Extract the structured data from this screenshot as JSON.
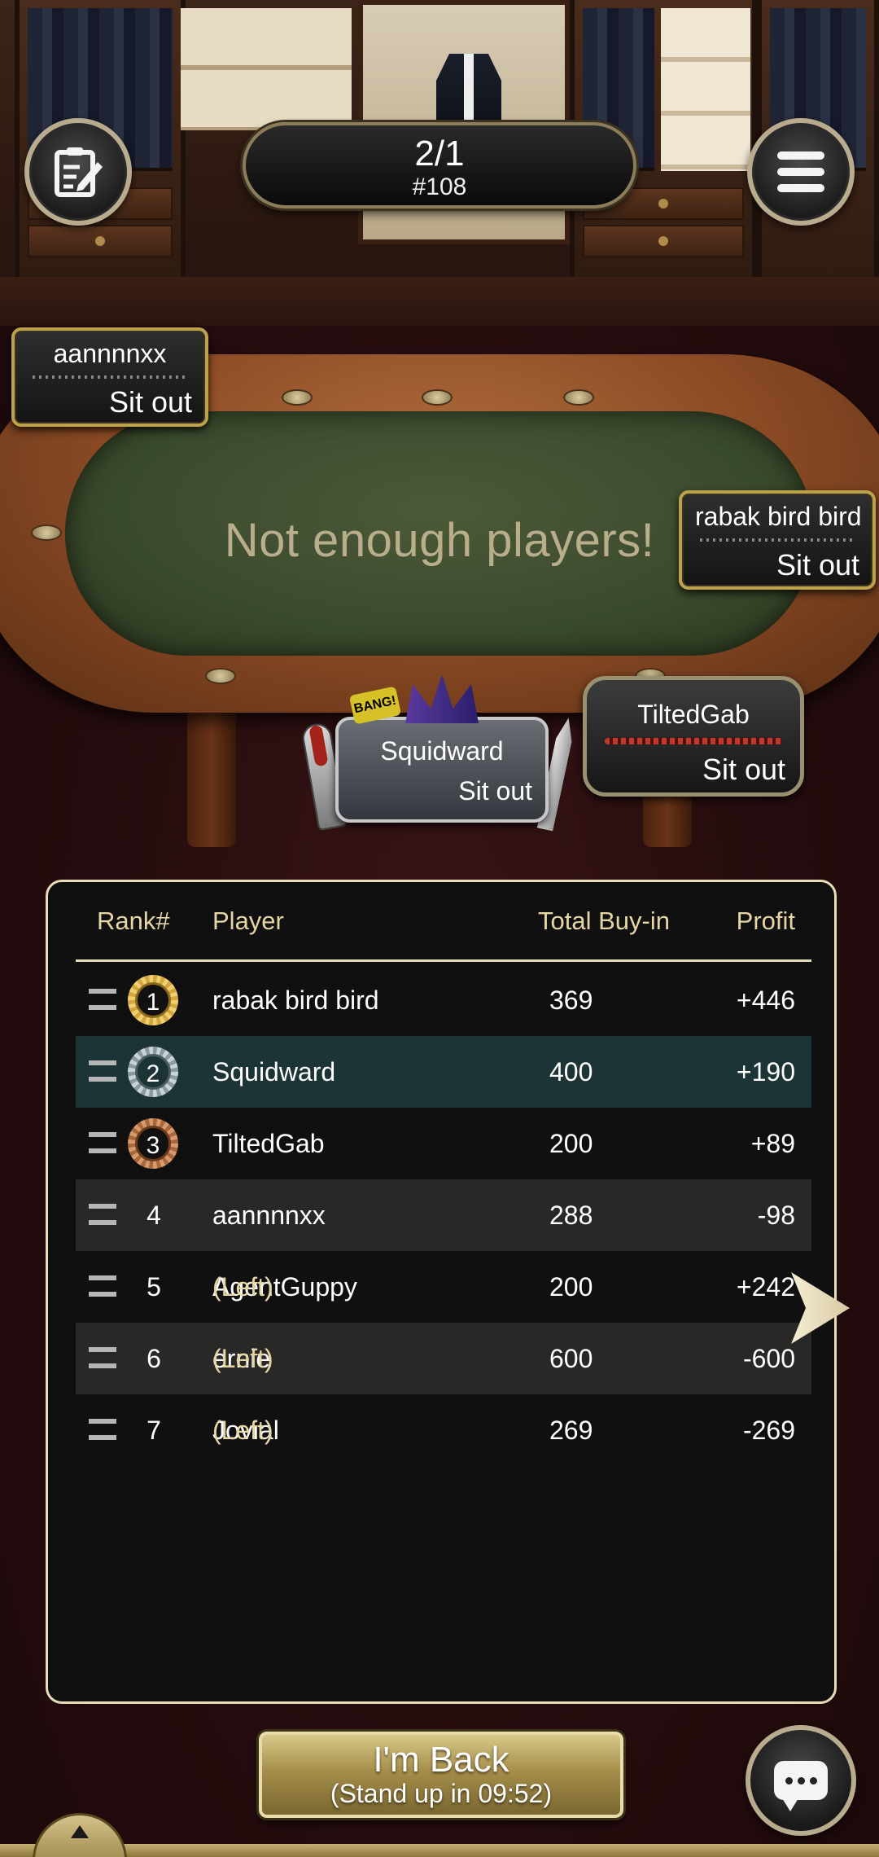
{
  "header": {
    "blinds": "2/1",
    "hand_number": "#108"
  },
  "table": {
    "message": "Not enough players!"
  },
  "seats": [
    {
      "name": "aannnnxx",
      "status": "Sit out"
    },
    {
      "name": "rabak bird bird",
      "status": "Sit out"
    },
    {
      "name": "TiltedGab",
      "status": "Sit out"
    },
    {
      "name": "Squidward",
      "status": "Sit out"
    }
  ],
  "squidward_sticker": "BANG!",
  "leaderboard": {
    "columns": {
      "rank": "Rank#",
      "player": "Player",
      "buyin": "Total Buy-in",
      "profit": "Profit"
    },
    "left_tag": "(Left)",
    "rows": [
      {
        "rank": "1",
        "player": "rabak bird bird",
        "buyin": "369",
        "profit": "+446"
      },
      {
        "rank": "2",
        "player": "Squidward",
        "buyin": "400",
        "profit": "+190"
      },
      {
        "rank": "3",
        "player": "TiltedGab",
        "buyin": "200",
        "profit": "+89"
      },
      {
        "rank": "4",
        "player": "aannnnxx",
        "buyin": "288",
        "profit": "-98"
      },
      {
        "rank": "5",
        "player": "AgentGuppy",
        "buyin": "200",
        "profit": "+242"
      },
      {
        "rank": "6",
        "player": "ernie",
        "buyin": "600",
        "profit": "-600"
      },
      {
        "rank": "7",
        "player": "Jovial",
        "buyin": "269",
        "profit": "-269"
      }
    ]
  },
  "actions": {
    "back_label": "I'm Back",
    "standup_label": "(Stand up in 09:52)"
  },
  "icons": {
    "notes": "notes-icon",
    "menu": "hamburger-icon",
    "chat": "chat-bubble-icon",
    "next": "arrow-right-icon",
    "drawer": "arrow-up-icon"
  },
  "colors": {
    "gold_text": "#e6d6a4",
    "highlight_row": "#1c3436",
    "seat_border": "#bda24e"
  }
}
